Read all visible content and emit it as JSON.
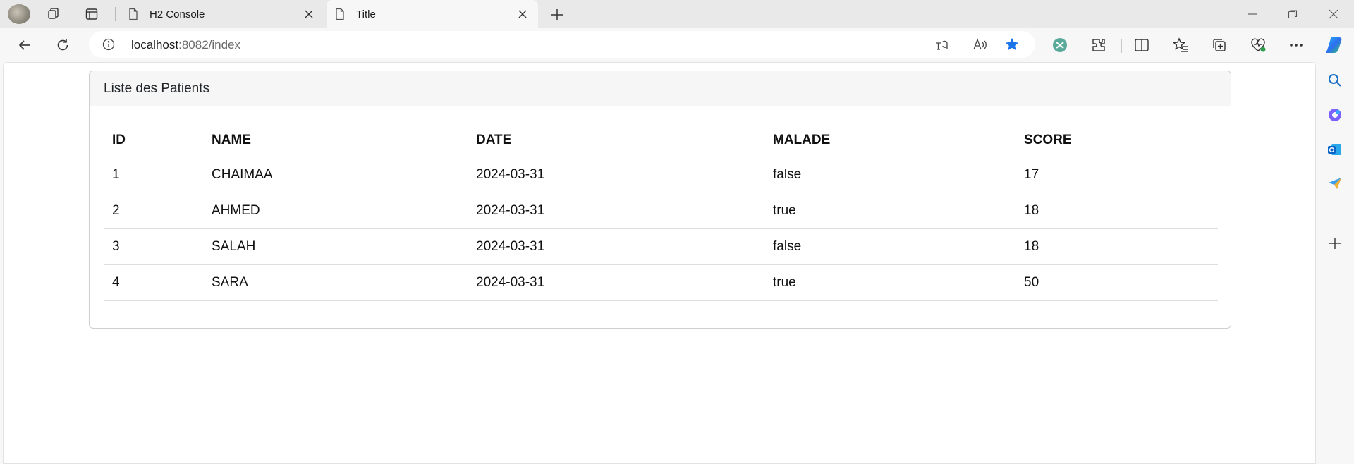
{
  "browser": {
    "tabs": [
      {
        "label": "H2 Console",
        "active": false
      },
      {
        "label": "Title",
        "active": true
      }
    ],
    "address": {
      "host": "localhost",
      "path": ":8082/index"
    }
  },
  "page": {
    "card_title": "Liste des Patients",
    "table": {
      "headers": [
        "ID",
        "NAME",
        "DATE",
        "MALADE",
        "SCORE"
      ],
      "rows": [
        [
          "1",
          "CHAIMAA",
          "2024-03-31",
          "false",
          "17"
        ],
        [
          "2",
          "AHMED",
          "2024-03-31",
          "true",
          "18"
        ],
        [
          "3",
          "SALAH",
          "2024-03-31",
          "false",
          "18"
        ],
        [
          "4",
          "SARA",
          "2024-03-31",
          "true",
          "50"
        ]
      ]
    }
  },
  "colors": {
    "favorite_star": "#1a73e8",
    "tab_strip": "#e9e9e9",
    "card_header": "#f6f6f6"
  }
}
